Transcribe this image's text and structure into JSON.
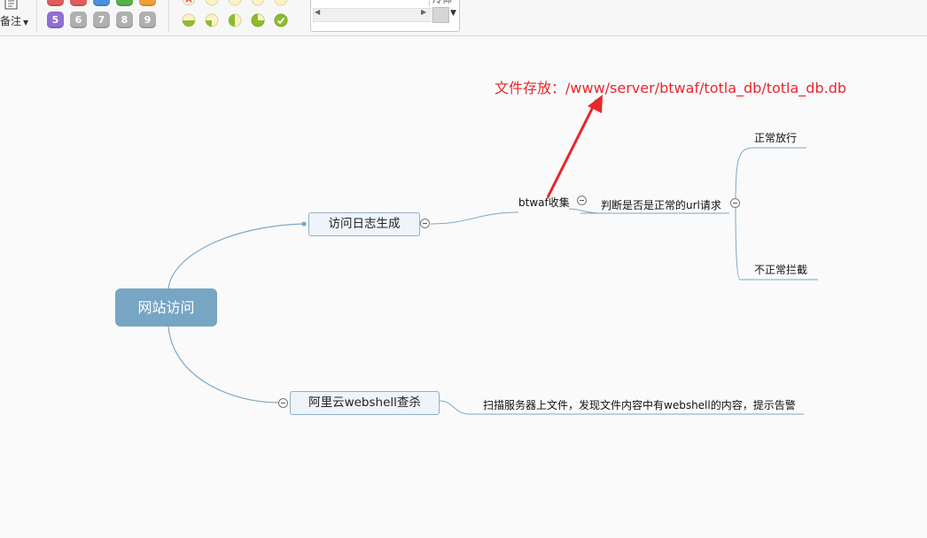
{
  "toolbar": {
    "note_label": "备注",
    "priority_visible": [
      "5",
      "6",
      "7",
      "8",
      "9"
    ],
    "priority_top_colors": [
      "#e25c5c",
      "#e25c5c",
      "#4a8fe0",
      "#56b24a",
      "#f0a030"
    ],
    "priority_bottom_colors": [
      "#8e6fd6",
      "#b0b0b0",
      "#b0b0b0",
      "#b0b0b0",
      "#b0b0b0"
    ],
    "progress_icons": [
      "progress-0-icon",
      "progress-25-icon",
      "progress-50-icon",
      "progress-75-icon",
      "progress-done-icon"
    ],
    "accent_green": "#8dbb2f",
    "widget_fragment": "冷仰"
  },
  "mindmap": {
    "central": "网站访问",
    "topic1": "访问日志生成",
    "topic2": "阿里云webshell查杀",
    "sub_btwaf": "btwaf收集",
    "sub_judge": "判断是否是正常的url请求",
    "sub_normal": "正常放行",
    "sub_abnormal": "不正常拦截",
    "sub_scan": "扫描服务器上文件，发现文件内容中有webshell的内容，提示告警"
  },
  "annotation": {
    "text": "文件存放：/www/server/btwaf/totla_db/totla_db.db",
    "color": "#e8272b"
  },
  "colors": {
    "central_fill": "#77a6c4",
    "connector": "#7fa6c2",
    "topic_fill": "#eef4f9",
    "topic_border": "#8fb0c9"
  }
}
